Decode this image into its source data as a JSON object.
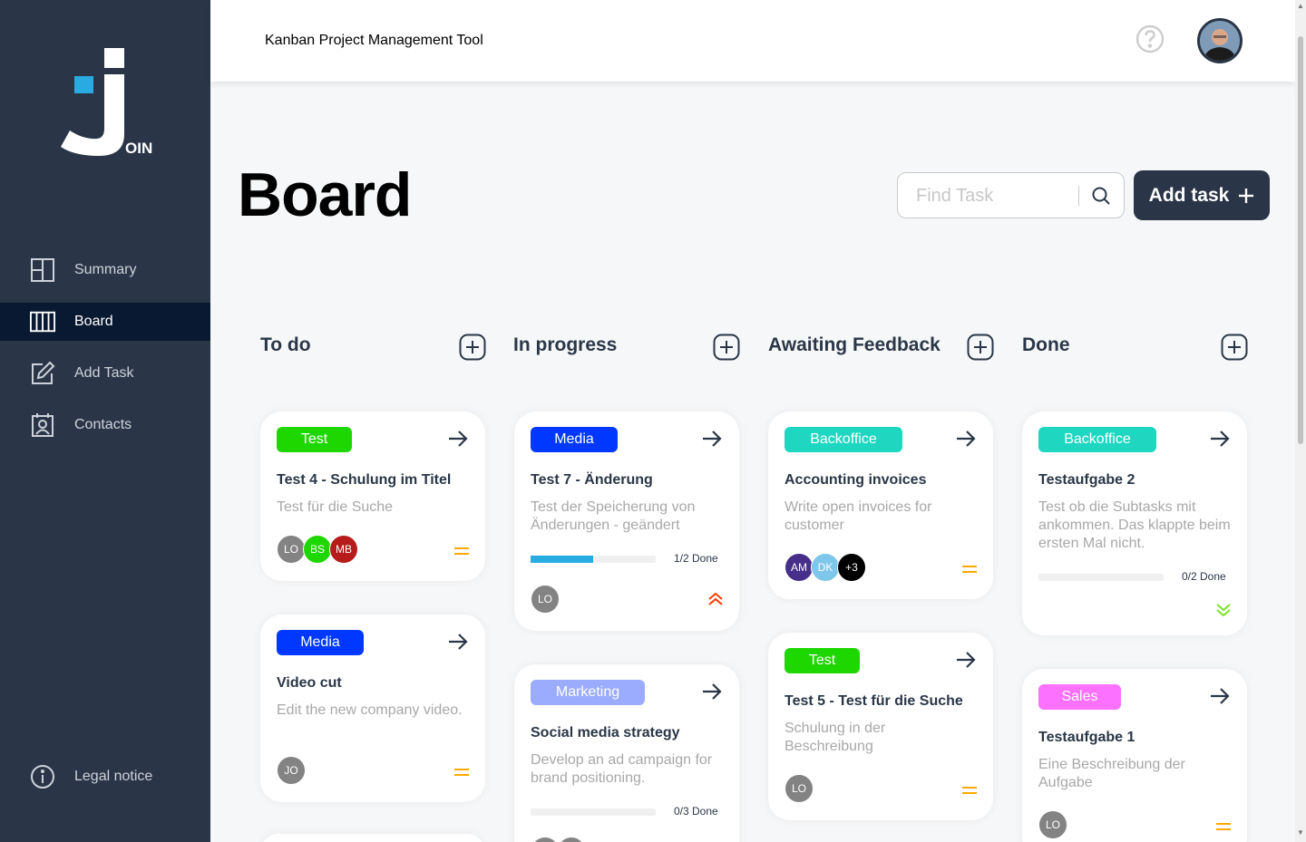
{
  "header": {
    "title": "Kanban Project Management Tool",
    "logo_text": "OIN"
  },
  "sidebar": {
    "items": [
      {
        "label": "Summary",
        "icon": "summary-icon"
      },
      {
        "label": "Board",
        "icon": "board-icon",
        "active": true
      },
      {
        "label": "Add Task",
        "icon": "add-task-icon"
      },
      {
        "label": "Contacts",
        "icon": "contacts-icon"
      }
    ],
    "legal": {
      "label": "Legal notice",
      "icon": "info-icon"
    }
  },
  "board": {
    "title": "Board",
    "search_placeholder": "Find Task",
    "add_task_label": "Add task",
    "columns": [
      {
        "title": "To do"
      },
      {
        "title": "In progress"
      },
      {
        "title": "Awaiting Feedback"
      },
      {
        "title": "Done"
      }
    ]
  },
  "colors": {
    "sidebar": "#2a3647",
    "active_nav": "#091931",
    "test": "#1fd700",
    "media": "#0038ff",
    "backoffice": "#1fd7c1",
    "marketing": "#9bacff",
    "sales": "#fc71ff",
    "prio_medium": "#ffa800",
    "prio_urgent": "#ff3d00",
    "prio_low": "#7ae229"
  },
  "cards": {
    "c1": {
      "tag": "Test",
      "title": "Test 4 - Schulung im Titel",
      "desc": "Test für die Suche",
      "assignees": [
        "LO",
        "BS",
        "MB"
      ],
      "priority": "medium"
    },
    "c2": {
      "tag": "Media",
      "title": "Video cut",
      "desc": "Edit the new company video.",
      "assignees": [
        "JO"
      ],
      "priority": "medium"
    },
    "c3": {
      "tag": "Media",
      "title": "Test 7 - Änderung",
      "desc": "Test der Speicherung von Änderungen - geändert",
      "progress": 0.5,
      "progress_label": "1/2 Done",
      "assignees": [
        "LO"
      ],
      "priority": "urgent"
    },
    "c4": {
      "tag": "Marketing",
      "title": "Social media strategy",
      "desc": "Develop an ad campaign for brand positioning.",
      "progress": 0,
      "progress_label": "0/3 Done"
    },
    "c5": {
      "tag": "Backoffice",
      "title": "Accounting invoices",
      "desc": "Write open invoices for customer",
      "assignees": [
        "AM",
        "DK",
        "+3"
      ],
      "priority": "medium"
    },
    "c6": {
      "tag": "Test",
      "title": "Test 5 - Test für die Suche",
      "desc": "Schulung in der Beschreibung",
      "assignees": [
        "LO"
      ],
      "priority": "medium"
    },
    "c7": {
      "tag": "Backoffice",
      "title": "Testaufgabe 2",
      "desc": "Test ob die Subtasks mit ankommen. Das klappte beim ersten Mal nicht.",
      "progress": 0,
      "progress_label": "0/2 Done",
      "priority": "low"
    },
    "c8": {
      "tag": "Sales",
      "title": "Testaufgabe 1",
      "desc": "Eine Beschreibung der Aufgabe",
      "assignees": [
        "LO"
      ],
      "priority": "medium"
    }
  }
}
